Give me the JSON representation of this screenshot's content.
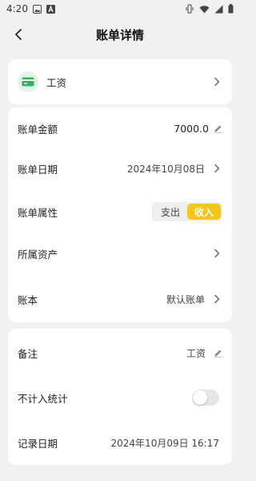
{
  "status_bar": {
    "time": "4:20",
    "icons_left": [
      "gallery-icon",
      "text-a-icon"
    ],
    "icons_right": [
      "vibrate-icon",
      "wifi-icon",
      "signal-icon",
      "battery-icon"
    ]
  },
  "header": {
    "title": "账单详情",
    "back_icon": "chevron-left-icon"
  },
  "category": {
    "name": "工资",
    "icon": "wallet-card-icon",
    "icon_color": "#35b05c"
  },
  "details": {
    "amount_label": "账单金额",
    "amount_value": "7000.0",
    "date_label": "账单日期",
    "date_value": "2024年10月08日",
    "attr_label": "账单属性",
    "attr_options": [
      "支出",
      "收入"
    ],
    "attr_selected": "收入",
    "asset_label": "所属资产",
    "asset_value": "",
    "book_label": "账本",
    "book_value": "默认账单"
  },
  "extra": {
    "note_label": "备注",
    "note_value": "工资",
    "exclude_label": "不计入统计",
    "exclude_enabled": false,
    "record_date_label": "记录日期",
    "record_date_value": "2024年10月09日 16:17"
  },
  "colors": {
    "accent": "#f5c518",
    "background": "#f1f1f1",
    "card": "#ffffff"
  }
}
